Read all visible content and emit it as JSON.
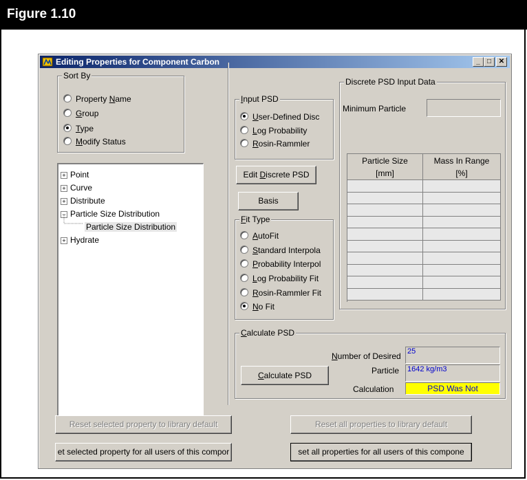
{
  "figure": {
    "title": "Figure 1.10"
  },
  "window": {
    "title": "Editing Properties for Component Carbon",
    "controls": {
      "minimize": "_",
      "maximize": "□",
      "close": "✕"
    }
  },
  "sort_by": {
    "label": "Sort By",
    "options": [
      {
        "pre": "Property ",
        "key": "N",
        "post": "ame",
        "selected": false
      },
      {
        "pre": "",
        "key": "G",
        "post": "roup",
        "selected": false
      },
      {
        "pre": "",
        "key": "T",
        "post": "ype",
        "selected": true
      },
      {
        "pre": "",
        "key": "M",
        "post": "odify Status",
        "selected": false
      }
    ]
  },
  "tree": {
    "nodes": [
      {
        "expander": "+",
        "label": "Point",
        "level": 0
      },
      {
        "expander": "+",
        "label": "Curve",
        "level": 0
      },
      {
        "expander": "+",
        "label": "Distribute",
        "level": 0
      },
      {
        "expander": "−",
        "label": "Particle Size Distribution",
        "level": 0
      },
      {
        "expander": "",
        "label": "Particle Size Distribution",
        "level": 1,
        "selected": true
      },
      {
        "expander": "+",
        "label": "Hydrate",
        "level": 0
      }
    ]
  },
  "input_psd": {
    "label_pre": "",
    "label_key": "I",
    "label_post": "nput PSD",
    "options": [
      {
        "pre": "",
        "key": "U",
        "post": "ser-Defined Disc",
        "selected": true
      },
      {
        "pre": "",
        "key": "L",
        "post": "og Probability",
        "selected": false
      },
      {
        "pre": "",
        "key": "R",
        "post": "osin-Rammler",
        "selected": false
      }
    ]
  },
  "buttons": {
    "edit_discrete_pre": "Edit ",
    "edit_discrete_key": "D",
    "edit_discrete_post": "iscrete PSD",
    "basis": "Basis",
    "calculate_pre": "",
    "calculate_key": "C",
    "calculate_post": "alculate PSD",
    "reset_selected": "Reset selected property to library default",
    "reset_all": "Reset all properties to library default",
    "set_selected": "et selected property for all users of this compor",
    "set_all": "set all properties for all users of this compone"
  },
  "fit_type": {
    "label_pre": "",
    "label_key": "F",
    "label_post": "it Type",
    "options": [
      {
        "pre": "",
        "key": "A",
        "post": "utoFit",
        "selected": false
      },
      {
        "pre": "",
        "key": "S",
        "post": "tandard Interpola",
        "selected": false
      },
      {
        "pre": "",
        "key": "P",
        "post": "robability Interpol",
        "selected": false
      },
      {
        "pre": "",
        "key": "L",
        "post": "og Probability Fit",
        "selected": false
      },
      {
        "pre": "",
        "key": "R",
        "post": "osin-Rammler Fit",
        "selected": false
      },
      {
        "pre": "",
        "key": "N",
        "post": "o Fit",
        "selected": true
      }
    ]
  },
  "discrete_psd": {
    "label": "Discrete PSD Input Data",
    "min_particle_label": "Minimum Particle",
    "min_particle_value": "",
    "columns": [
      {
        "line1": "Particle Size",
        "line2": "[mm]"
      },
      {
        "line1": "Mass In Range",
        "line2": "[%]"
      }
    ]
  },
  "calculate_psd": {
    "label_pre": "",
    "label_key": "C",
    "label_post": "alculate PSD",
    "num_desired_pre": "",
    "num_desired_key": "N",
    "num_desired_post": "umber of Desired",
    "num_desired_value": "25",
    "particle_label": "Particle",
    "particle_value": "1642 kg/m3",
    "calculation_label": "Calculation",
    "calculation_value": "PSD Was Not"
  },
  "colors": {
    "title_start": "#0a246a",
    "title_end": "#a6caf0",
    "highlight": "#ffff00",
    "value_text": "#0000cc"
  }
}
